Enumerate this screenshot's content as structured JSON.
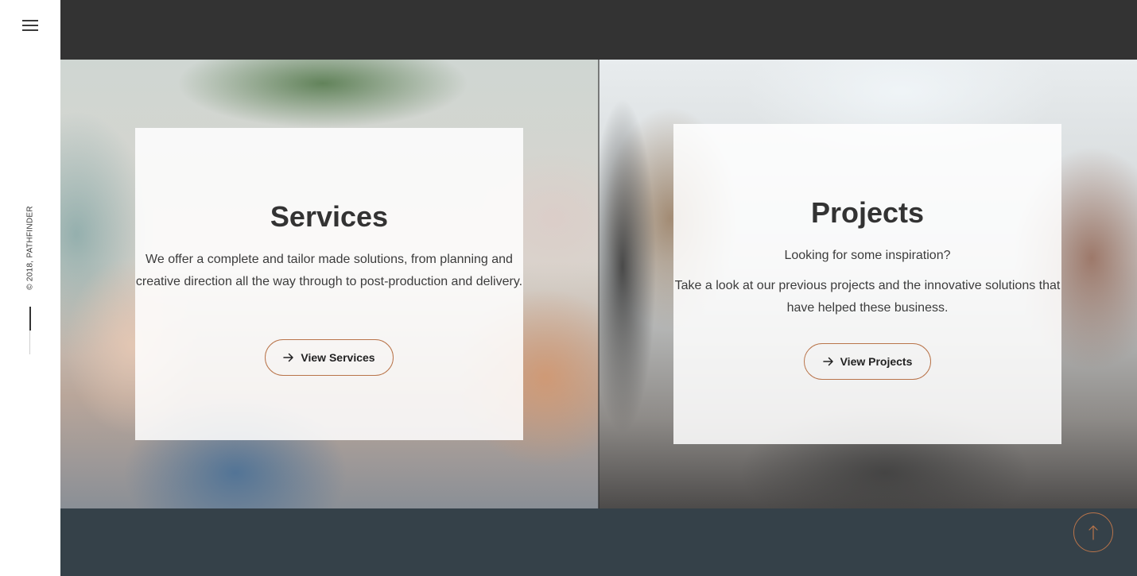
{
  "sidebar": {
    "menu_icon": "hamburger-menu-icon",
    "copyright": "© 2018, PATHFINDER"
  },
  "services": {
    "title": "Services",
    "description": "We offer a complete and tailor made solutions, from planning and creative direction all the way through to post-production and delivery.",
    "button_label": "View Services",
    "button_icon": "arrow-right-icon"
  },
  "projects": {
    "title": "Projects",
    "intro": "Looking for some inspiration?",
    "description": "Take a look at our previous projects and the innovative solutions that have helped these business.",
    "button_label": "View Projects",
    "button_icon": "arrow-right-icon"
  },
  "back_to_top_icon": "arrow-up-icon",
  "colors": {
    "top_band": "#333333",
    "bottom_band": "#354149",
    "accent_border": "#b9744a",
    "heading": "#333333"
  }
}
